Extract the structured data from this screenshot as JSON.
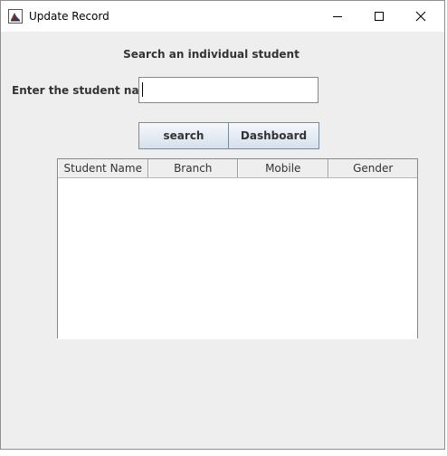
{
  "window": {
    "title": "Update Record",
    "icons": {
      "app": "java-cup-icon",
      "minimize": "minimize-icon",
      "maximize": "maximize-icon",
      "close": "close-icon"
    }
  },
  "form": {
    "heading": "Search an individual student",
    "name_label": "Enter the student name:",
    "name_value": "",
    "name_placeholder": ""
  },
  "buttons": {
    "search_label": "search",
    "dashboard_label": "Dashboard"
  },
  "table": {
    "columns": [
      "Student Name",
      "Branch",
      "Mobile",
      "Gender"
    ],
    "rows": []
  }
}
